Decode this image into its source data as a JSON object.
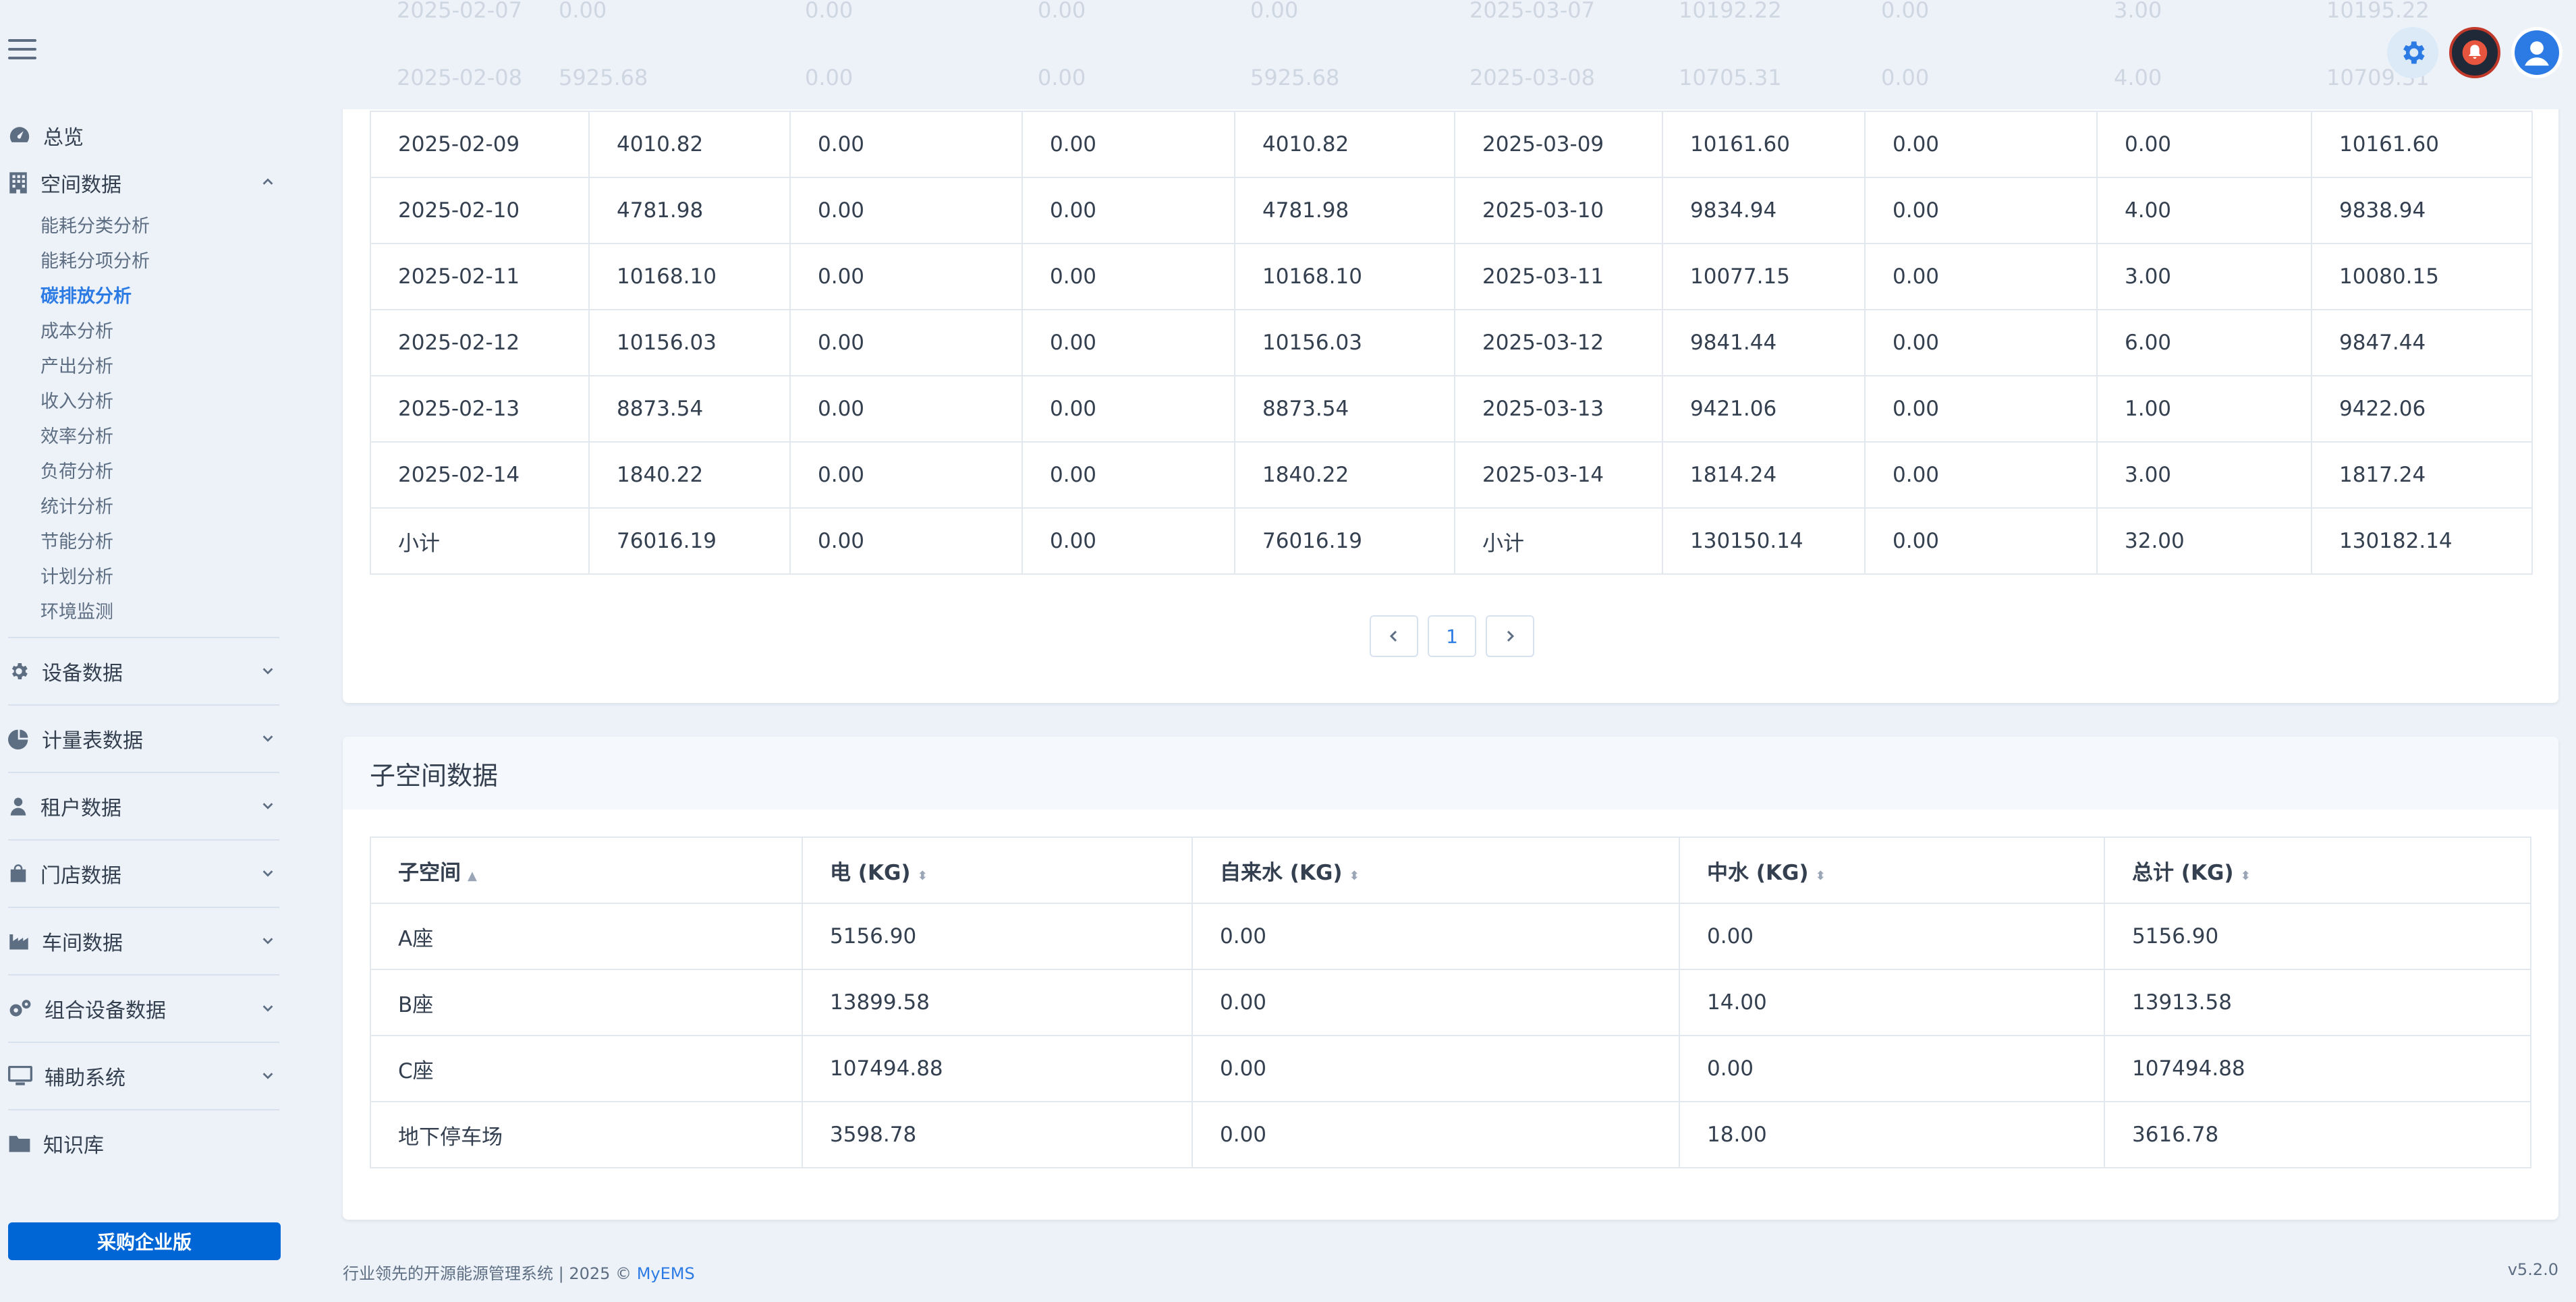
{
  "ghost_rows": [
    [
      "2025-02-07",
      "0.00",
      "0.00",
      "0.00",
      "0.00",
      "2025-03-07",
      "10192.22",
      "0.00",
      "3.00",
      "10195.22"
    ],
    [
      "2025-02-08",
      "5925.68",
      "0.00",
      "0.00",
      "5925.68",
      "2025-03-08",
      "10705.31",
      "0.00",
      "4.00",
      "10709.31"
    ]
  ],
  "sidebar": {
    "items": [
      {
        "label": "总览",
        "icon": "dashboard-icon"
      },
      {
        "label": "空间数据",
        "icon": "building-icon",
        "expanded": true
      }
    ],
    "sub_items": [
      "能耗分类分析",
      "能耗分项分析",
      "碳排放分析",
      "成本分析",
      "产出分析",
      "收入分析",
      "效率分析",
      "负荷分析",
      "统计分析",
      "节能分析",
      "计划分析",
      "环境监测"
    ],
    "active_sub": "碳排放分析",
    "groups": [
      {
        "label": "设备数据",
        "icon": "gear-icon"
      },
      {
        "label": "计量表数据",
        "icon": "pie-chart-icon"
      },
      {
        "label": "租户数据",
        "icon": "person-icon"
      },
      {
        "label": "门店数据",
        "icon": "shopping-bag-icon"
      },
      {
        "label": "车间数据",
        "icon": "factory-icon"
      },
      {
        "label": "组合设备数据",
        "icon": "gears-icon"
      },
      {
        "label": "辅助系统",
        "icon": "monitor-icon"
      }
    ],
    "knowledge": {
      "label": "知识库",
      "icon": "folder-icon"
    },
    "buy_button": "采购企业版"
  },
  "main_table": {
    "rows": [
      [
        "2025-02-09",
        "4010.82",
        "0.00",
        "0.00",
        "4010.82",
        "2025-03-09",
        "10161.60",
        "0.00",
        "0.00",
        "10161.60"
      ],
      [
        "2025-02-10",
        "4781.98",
        "0.00",
        "0.00",
        "4781.98",
        "2025-03-10",
        "9834.94",
        "0.00",
        "4.00",
        "9838.94"
      ],
      [
        "2025-02-11",
        "10168.10",
        "0.00",
        "0.00",
        "10168.10",
        "2025-03-11",
        "10077.15",
        "0.00",
        "3.00",
        "10080.15"
      ],
      [
        "2025-02-12",
        "10156.03",
        "0.00",
        "0.00",
        "10156.03",
        "2025-03-12",
        "9841.44",
        "0.00",
        "6.00",
        "9847.44"
      ],
      [
        "2025-02-13",
        "8873.54",
        "0.00",
        "0.00",
        "8873.54",
        "2025-03-13",
        "9421.06",
        "0.00",
        "1.00",
        "9422.06"
      ],
      [
        "2025-02-14",
        "1840.22",
        "0.00",
        "0.00",
        "1840.22",
        "2025-03-14",
        "1814.24",
        "0.00",
        "3.00",
        "1817.24"
      ],
      [
        "小计",
        "76016.19",
        "0.00",
        "0.00",
        "76016.19",
        "小计",
        "130150.14",
        "0.00",
        "32.00",
        "130182.14"
      ]
    ],
    "pagination": {
      "current": "1"
    }
  },
  "subspace": {
    "title": "子空间数据",
    "headers": [
      "子空间",
      "电 (KG)",
      "自来水 (KG)",
      "中水 (KG)",
      "总计 (KG)"
    ],
    "rows": [
      [
        "A座",
        "5156.90",
        "0.00",
        "0.00",
        "5156.90"
      ],
      [
        "B座",
        "13899.58",
        "0.00",
        "14.00",
        "13913.58"
      ],
      [
        "C座",
        "107494.88",
        "0.00",
        "0.00",
        "107494.88"
      ],
      [
        "地下停车场",
        "3598.78",
        "0.00",
        "18.00",
        "3616.78"
      ]
    ]
  },
  "footer": {
    "text": "行业领先的开源能源管理系统 | 2025 © ",
    "brand": "MyEMS",
    "version": "v5.2.0"
  }
}
